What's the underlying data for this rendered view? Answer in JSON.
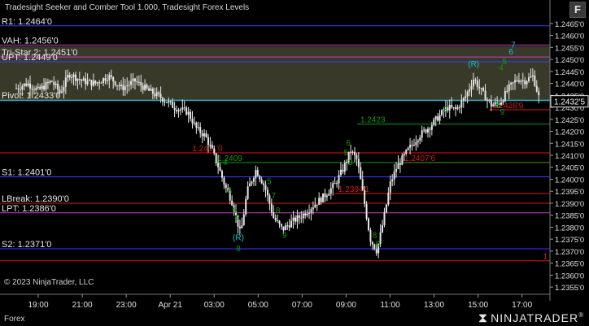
{
  "header": {
    "title": "Tradesight Seeker and Comber Tool 1.000, Tradesight Forex Levels",
    "f_button": "F"
  },
  "footer": {
    "copyright": "© 2023 NinjaTrader, LLC",
    "instrument": "Forex",
    "logo_text": "NINJATRADER",
    "logo_mark": "®"
  },
  "colors": {
    "background": "#000000",
    "candle": "#e6e6e6",
    "level_blue": "#3a3aff",
    "level_red": "#d81a1a",
    "level_purple": "#c040c0",
    "level_cyan": "#22d0ff",
    "zone_fill": "#3f3f2f",
    "setup_green": "#0e9a0e",
    "countdown_cyan": "#19c8c8",
    "current_price_box": "#000000"
  },
  "chart_data": {
    "type": "candlestick",
    "ylim": [
      1.2352,
      1.2468
    ],
    "y_ticks": [
      "1.2355'0",
      "1.2360'0",
      "1.2365'0",
      "1.2370'0",
      "1.2375'0",
      "1.2380'0",
      "1.2385'0",
      "1.2390'0",
      "1.2395'0",
      "1.2400'0",
      "1.2405'0",
      "1.2410'0",
      "1.2415'0",
      "1.2420'0",
      "1.2425'0",
      "1.2430'0",
      "1.2435'0",
      "1.2440'0",
      "1.2445'0",
      "1.2450'0",
      "1.2455'0",
      "1.2460'0",
      "1.2465'0"
    ],
    "x_ticks": [
      {
        "label": "19:00",
        "t": 1
      },
      {
        "label": "21:00",
        "t": 3
      },
      {
        "label": "23:00",
        "t": 5
      },
      {
        "label": "Apr 21",
        "t": 7
      },
      {
        "label": "03:00",
        "t": 9
      },
      {
        "label": "05:00",
        "t": 11
      },
      {
        "label": "07:00",
        "t": 13
      },
      {
        "label": "09:00",
        "t": 15
      },
      {
        "label": "11:00",
        "t": 17
      },
      {
        "label": "13:00",
        "t": 19
      },
      {
        "label": "15:00",
        "t": 21
      },
      {
        "label": "17:00",
        "t": 23
      }
    ],
    "x_range": [
      0,
      23.9
    ],
    "series_anchors": [
      [
        0.0,
        1.2438
      ],
      [
        0.5,
        1.244
      ],
      [
        1.0,
        1.2437
      ],
      [
        1.6,
        1.2441
      ],
      [
        2.0,
        1.2436
      ],
      [
        2.4,
        1.2444
      ],
      [
        3.0,
        1.2441
      ],
      [
        3.6,
        1.244
      ],
      [
        4.2,
        1.2443
      ],
      [
        4.8,
        1.2438
      ],
      [
        5.4,
        1.2441
      ],
      [
        6.0,
        1.2437
      ],
      [
        6.6,
        1.2434
      ],
      [
        7.2,
        1.243
      ],
      [
        7.8,
        1.2428
      ],
      [
        8.2,
        1.2421
      ],
      [
        8.6,
        1.2418
      ],
      [
        8.9,
        1.2412
      ],
      [
        9.2,
        1.2405
      ],
      [
        9.5,
        1.2397
      ],
      [
        9.8,
        1.2391
      ],
      [
        10.0,
        1.2384
      ],
      [
        10.2,
        1.2377
      ],
      [
        10.5,
        1.2395
      ],
      [
        10.9,
        1.2404
      ],
      [
        11.3,
        1.2397
      ],
      [
        11.7,
        1.2384
      ],
      [
        12.1,
        1.2379
      ],
      [
        12.5,
        1.2382
      ],
      [
        13.0,
        1.2385
      ],
      [
        13.5,
        1.2389
      ],
      [
        14.0,
        1.2393
      ],
      [
        14.5,
        1.2398
      ],
      [
        14.9,
        1.2405
      ],
      [
        15.2,
        1.2412
      ],
      [
        15.5,
        1.2408
      ],
      [
        15.8,
        1.2392
      ],
      [
        16.1,
        1.2375
      ],
      [
        16.4,
        1.237
      ],
      [
        16.7,
        1.2383
      ],
      [
        17.0,
        1.2398
      ],
      [
        17.3,
        1.2405
      ],
      [
        17.8,
        1.2412
      ],
      [
        18.3,
        1.2418
      ],
      [
        18.8,
        1.2422
      ],
      [
        19.2,
        1.2426
      ],
      [
        19.6,
        1.243
      ],
      [
        20.0,
        1.2429
      ],
      [
        20.4,
        1.2434
      ],
      [
        20.8,
        1.2442
      ],
      [
        21.2,
        1.2436
      ],
      [
        21.6,
        1.2431
      ],
      [
        22.0,
        1.2432
      ],
      [
        22.4,
        1.2438
      ],
      [
        22.8,
        1.2442
      ],
      [
        23.1,
        1.2441
      ],
      [
        23.5,
        1.2443
      ],
      [
        23.8,
        1.2433
      ]
    ],
    "zone": {
      "from": 1.24325,
      "to": 1.24555
    },
    "levels": [
      {
        "label": "R1: 1.2464'0",
        "value": 1.2464,
        "color": "#3a3aff",
        "x_from": 0,
        "label_x": "left"
      },
      {
        "label": "VAH: 1.2456'0",
        "value": 1.2456,
        "color": "#c040c0",
        "x_from": 0,
        "label_x": "left"
      },
      {
        "label": "Tri-Star 2: 1.2451'0",
        "value": 1.2451,
        "color": "#c040c0",
        "x_from": 0,
        "label_x": "left"
      },
      {
        "label": "UPT: 1.2449'0",
        "value": 1.2449,
        "color": "#3a3aff",
        "x_from": 0,
        "label_x": "left"
      },
      {
        "label": "Pivot: 1.2433'0",
        "value": 1.2433,
        "color": "#22d0ff",
        "x_from": 0,
        "label_x": "left"
      },
      {
        "label": "1.2411'0",
        "value": 1.2411,
        "color": "#d81a1a",
        "x_from": 0,
        "label_x": "mid"
      },
      {
        "label": "S1: 1.2401'0",
        "value": 1.2401,
        "color": "#3a3aff",
        "x_from": 0,
        "label_x": "left"
      },
      {
        "label": "LBreak: 1.2390'0",
        "value": 1.239,
        "color": "#d81a1a",
        "x_from": 0,
        "label_x": "left"
      },
      {
        "label": "LPT: 1.2386'0",
        "value": 1.2386,
        "color": "#c040c0",
        "x_from": 0,
        "label_x": "left"
      },
      {
        "label": "S2: 1.2371'0",
        "value": 1.2371,
        "color": "#3a3aff",
        "x_from": 0,
        "label_x": "left"
      },
      {
        "label": "1",
        "value": 1.2366,
        "color": "#d81a1a",
        "x_from": 0,
        "label_x": "right"
      },
      {
        "label": "1.2394'1",
        "value": 1.2394,
        "color": "#d81a1a",
        "x_from": 14.5,
        "label_x": "from"
      },
      {
        "label": "1.2407'6",
        "value": 1.2407,
        "color": "#d81a1a",
        "x_from": 17.5,
        "label_x": "from"
      },
      {
        "label": "1.2428'9",
        "value": 1.2429,
        "color": "#d81a1a",
        "x_from": 21.5,
        "label_x": "from"
      },
      {
        "label": "1.2409",
        "value": 1.2407,
        "color": "#0e9a0e",
        "x_from": 9.0,
        "label_x": "from"
      },
      {
        "label": "1.2423",
        "value": 1.2423,
        "color": "#0e9a0e",
        "x_from": 15.5,
        "label_x": "from"
      }
    ],
    "setup_labels": [
      {
        "text": "(R)",
        "t": 10.1,
        "y": 1.23745,
        "color": "#19c8c8"
      },
      {
        "text": "8",
        "t": 10.1,
        "y": 1.237,
        "color": "#0e9a0e"
      },
      {
        "text": "9",
        "t": 12.2,
        "y": 1.23755,
        "color": "#0e9a0e"
      },
      {
        "text": "(R)",
        "t": 20.8,
        "y": 1.2447,
        "color": "#19c8c8"
      },
      {
        "text": "7",
        "t": 22.6,
        "y": 1.2455,
        "color": "#19c8c8"
      },
      {
        "text": "6",
        "t": 22.5,
        "y": 1.2452,
        "color": "#19c8c8"
      },
      {
        "text": "5",
        "t": 22.2,
        "y": 1.2448,
        "color": "#0e9a0e"
      },
      {
        "text": "4",
        "t": 22.05,
        "y": 1.24455,
        "color": "#0e9a0e"
      },
      {
        "text": "9",
        "t": 10.05,
        "y": 1.2383,
        "color": "#0e9a0e"
      },
      {
        "text": "8",
        "t": 9.95,
        "y": 1.2386,
        "color": "#0e9a0e"
      },
      {
        "text": "4",
        "t": 9.5,
        "y": 1.2406,
        "color": "#0e9a0e"
      },
      {
        "text": "6",
        "t": 9.7,
        "y": 1.2394,
        "color": "#0e9a0e"
      },
      {
        "text": "7",
        "t": 11.7,
        "y": 1.2392,
        "color": "#0e9a0e"
      },
      {
        "text": "8",
        "t": 11.9,
        "y": 1.2386,
        "color": "#0e9a0e"
      },
      {
        "text": "5",
        "t": 11.5,
        "y": 1.2398,
        "color": "#0e9a0e"
      },
      {
        "text": "6",
        "t": 15.1,
        "y": 1.2414,
        "color": "#0e9a0e"
      },
      {
        "text": "5",
        "t": 15.0,
        "y": 1.241,
        "color": "#0e9a0e"
      },
      {
        "text": "3",
        "t": 15.2,
        "y": 1.2406,
        "color": "#0e9a0e"
      },
      {
        "text": "8",
        "t": 16.3,
        "y": 1.23755,
        "color": "#0e9a0e"
      },
      {
        "text": "9",
        "t": 16.45,
        "y": 1.2372,
        "color": "#0e9a0e"
      },
      {
        "text": "3",
        "t": 19.5,
        "y": 1.2428,
        "color": "#0e9a0e"
      },
      {
        "text": "8",
        "t": 21.9,
        "y": 1.243,
        "color": "#0e9a0e"
      },
      {
        "text": "9",
        "t": 22.1,
        "y": 1.2427,
        "color": "#0e9a0e"
      }
    ],
    "current_price": {
      "label": "1.2432'5",
      "value": 1.24325
    }
  }
}
